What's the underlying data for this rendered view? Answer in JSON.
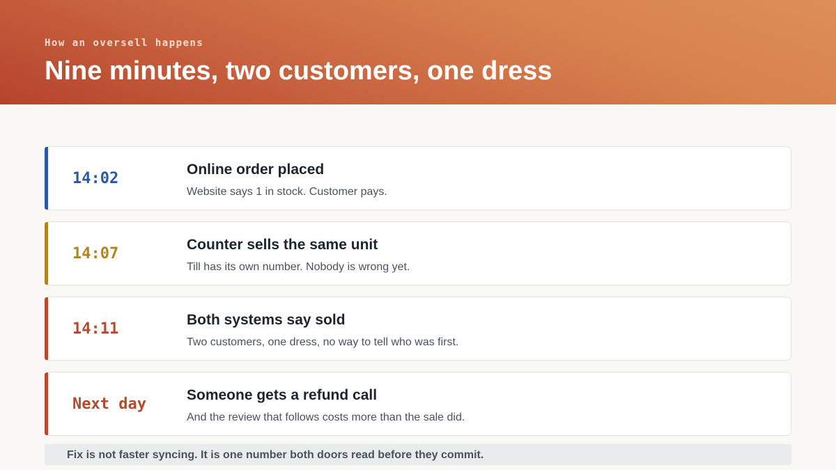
{
  "header": {
    "eyebrow": "How an oversell happens",
    "title": "Nine minutes, two customers, one dress"
  },
  "timeline": [
    {
      "time": "14:02",
      "title": "Online order placed",
      "description": "Website says 1 in stock. Customer pays.",
      "color": "#2c5aa0"
    },
    {
      "time": "14:07",
      "title": "Counter sells the same unit",
      "description": "Till has its own number. Nobody is wrong yet.",
      "color": "#b08423"
    },
    {
      "time": "14:11",
      "title": "Both systems say sold",
      "description": "Two customers, one dress, no way to tell who was first.",
      "color": "#b44a2e"
    },
    {
      "time": "Next day",
      "title": "Someone gets a refund call",
      "description": "And the review that follows costs more than the sale did.",
      "color": "#b44a2e"
    }
  ],
  "footer": {
    "note": "Fix is not faster syncing. It is one number both doors read before they commit."
  }
}
